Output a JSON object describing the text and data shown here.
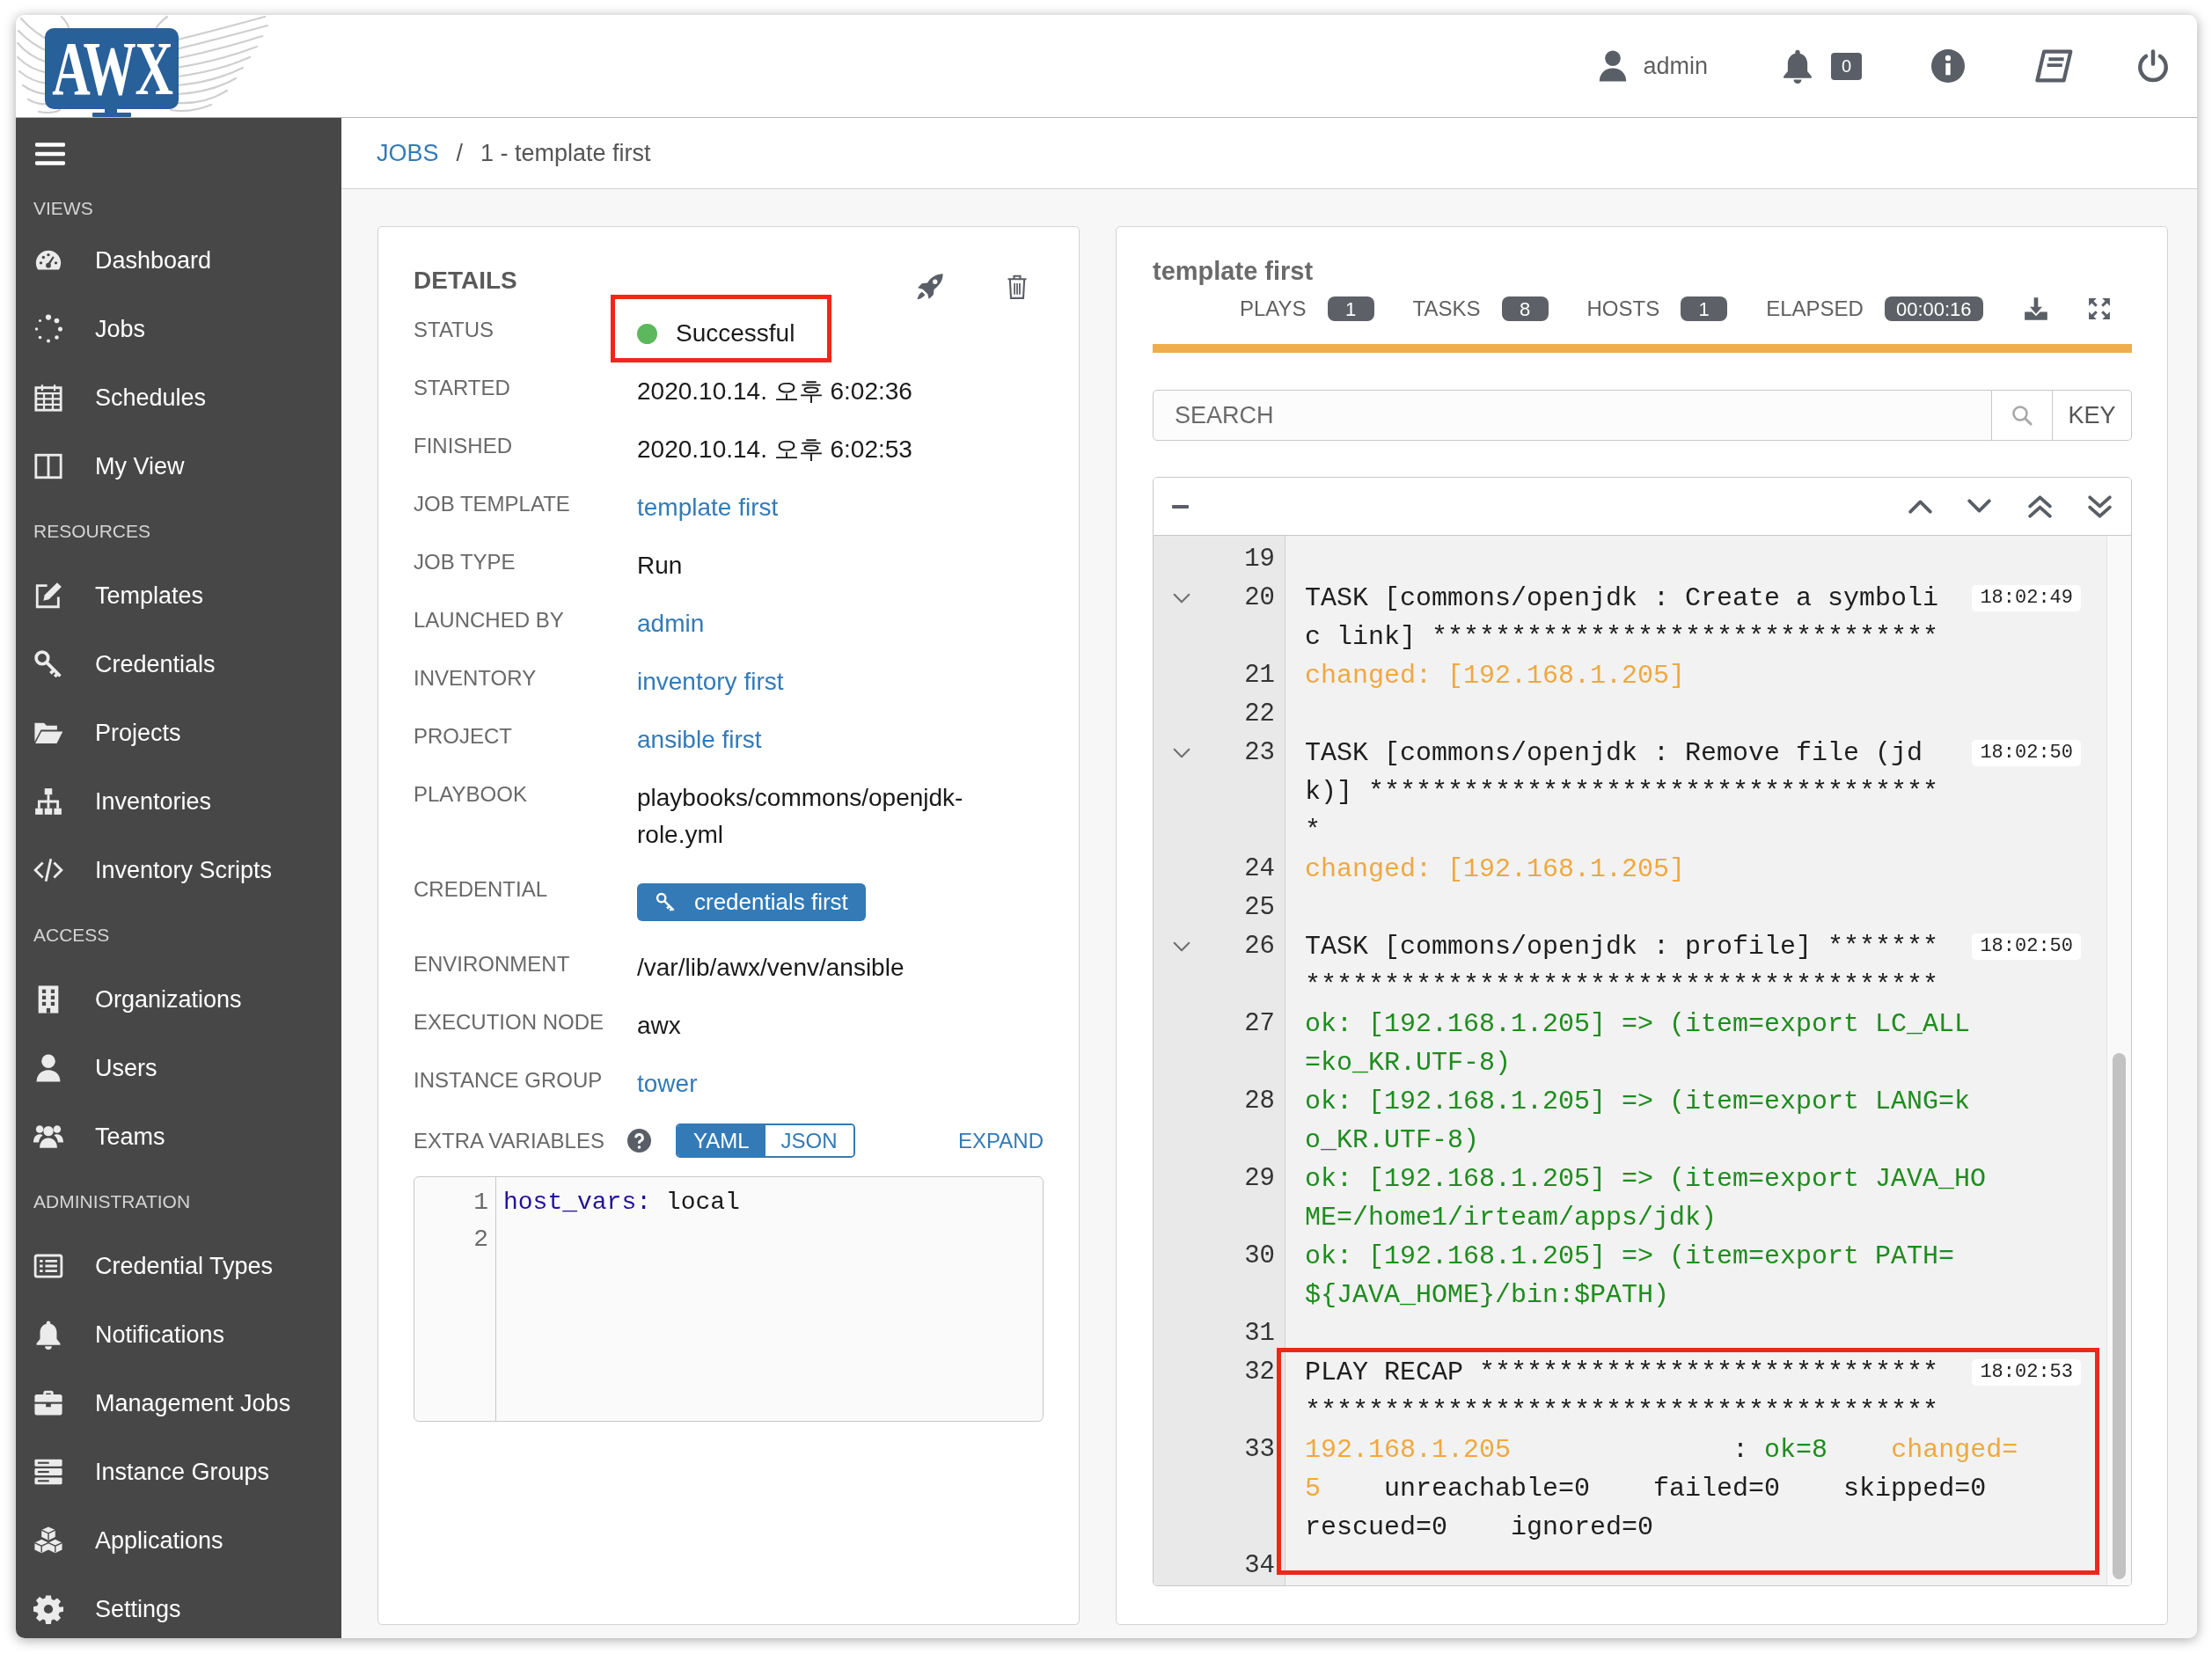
{
  "header": {
    "logo": "AWX",
    "user": "admin",
    "notification_count": "0"
  },
  "sidebar": {
    "sections": [
      {
        "title": "VIEWS",
        "items": [
          "Dashboard",
          "Jobs",
          "Schedules",
          "My View"
        ]
      },
      {
        "title": "RESOURCES",
        "items": [
          "Templates",
          "Credentials",
          "Projects",
          "Inventories",
          "Inventory Scripts"
        ]
      },
      {
        "title": "ACCESS",
        "items": [
          "Organizations",
          "Users",
          "Teams"
        ]
      },
      {
        "title": "ADMINISTRATION",
        "items": [
          "Credential Types",
          "Notifications",
          "Management Jobs",
          "Instance Groups",
          "Applications",
          "Settings"
        ]
      }
    ]
  },
  "breadcrumb": {
    "separator": "/",
    "items": [
      {
        "label": "JOBS",
        "kind": "link"
      },
      {
        "label": "1 - template first",
        "kind": "current"
      }
    ]
  },
  "details": {
    "title": "DETAILS",
    "fields": [
      {
        "label": "STATUS",
        "kind": "status",
        "value": "Successful",
        "color": "#5cb85c",
        "highlighted": true
      },
      {
        "label": "STARTED",
        "kind": "text",
        "value": "2020.10.14. 오후 6:02:36"
      },
      {
        "label": "FINISHED",
        "kind": "text",
        "value": "2020.10.14. 오후 6:02:53"
      },
      {
        "label": "JOB TEMPLATE",
        "kind": "link",
        "value": "template first"
      },
      {
        "label": "JOB TYPE",
        "kind": "text",
        "value": "Run"
      },
      {
        "label": "LAUNCHED BY",
        "kind": "link",
        "value": "admin"
      },
      {
        "label": "INVENTORY",
        "kind": "link",
        "value": "inventory first"
      },
      {
        "label": "PROJECT",
        "kind": "link",
        "value": "ansible first"
      },
      {
        "label": "PLAYBOOK",
        "kind": "text",
        "value": "playbooks/commons/openjdk-role.yml"
      },
      {
        "label": "CREDENTIAL",
        "kind": "chip",
        "value": "credentials first"
      },
      {
        "label": "ENVIRONMENT",
        "kind": "text",
        "value": "/var/lib/awx/venv/ansible"
      },
      {
        "label": "EXECUTION NODE",
        "kind": "text",
        "value": "awx"
      },
      {
        "label": "INSTANCE GROUP",
        "kind": "link",
        "value": "tower"
      }
    ],
    "extra_variables": {
      "label": "EXTRA VARIABLES",
      "modes": [
        {
          "label": "YAML",
          "selected": true
        },
        {
          "label": "JSON",
          "selected": false
        }
      ],
      "expand": "EXPAND",
      "code": [
        {
          "number": "1",
          "segments": [
            {
              "text": "host_vars:",
              "kind": "key"
            },
            {
              "text": " local",
              "kind": "plain"
            }
          ]
        },
        {
          "number": "2"
        }
      ]
    }
  },
  "job_output": {
    "title": "template first",
    "stats": [
      {
        "label": "PLAYS",
        "value": "1"
      },
      {
        "label": "TASKS",
        "value": "8"
      },
      {
        "label": "HOSTS",
        "value": "1"
      },
      {
        "label": "ELAPSED",
        "value": "00:00:16"
      }
    ],
    "status_bar": {
      "level": 1
    },
    "search": {
      "placeholder": "SEARCH",
      "key_button": "KEY"
    },
    "lines": [
      {
        "number": "19"
      },
      {
        "number": "20",
        "kind": "task",
        "expanded": true,
        "time": "18:02:49",
        "rows": [
          "TASK [commons/openjdk : Create a symboli",
          "c link] ********************************"
        ]
      },
      {
        "number": "21",
        "kind": "changed",
        "rows": [
          "changed: [192.168.1.205]"
        ]
      },
      {
        "number": "22"
      },
      {
        "number": "23",
        "kind": "task",
        "expanded": true,
        "time": "18:02:50",
        "rows": [
          "TASK [commons/openjdk : Remove file (jd",
          "k)] ************************************",
          "*"
        ]
      },
      {
        "number": "24",
        "kind": "changed",
        "rows": [
          "changed: [192.168.1.205]"
        ]
      },
      {
        "number": "25"
      },
      {
        "number": "26",
        "kind": "task",
        "expanded": true,
        "time": "18:02:50",
        "rows": [
          "TASK [commons/openjdk : profile] *******",
          "****************************************"
        ]
      },
      {
        "number": "27",
        "kind": "ok",
        "rows": [
          "ok: [192.168.1.205] => (item=export LC_ALL",
          "=ko_KR.UTF-8)"
        ]
      },
      {
        "number": "28",
        "kind": "ok",
        "rows": [
          "ok: [192.168.1.205] => (item=export LANG=k",
          "o_KR.UTF-8)"
        ]
      },
      {
        "number": "29",
        "kind": "ok",
        "rows": [
          "ok: [192.168.1.205] => (item=export JAVA_HO",
          "ME=/home1/irteam/apps/jdk)"
        ]
      },
      {
        "number": "30",
        "kind": "ok",
        "rows": [
          "ok: [192.168.1.205] => (item=export PATH=",
          "${JAVA_HOME}/bin:$PATH)"
        ]
      },
      {
        "number": "31"
      },
      {
        "number": "32",
        "kind": "play",
        "time": "18:02:53",
        "highlighted": true,
        "rows": [
          "PLAY RECAP *****************************",
          "****************************************"
        ]
      },
      {
        "number": "33",
        "kind": "stats",
        "highlighted": true,
        "rows": [
          [
            {
              "text": "192.168.1.205",
              "kind": "changed"
            },
            {
              "text": "              : ",
              "kind": "plain"
            },
            {
              "text": "ok=8",
              "kind": "ok"
            },
            {
              "text": "    ",
              "kind": "plain"
            },
            {
              "text": "changed=",
              "kind": "changed"
            }
          ],
          [
            {
              "text": "5",
              "kind": "changed"
            },
            {
              "text": "    unreachable=0    failed=0    skipped=0",
              "kind": "plain"
            }
          ],
          [
            {
              "text": "rescued=0    ignored=0",
              "kind": "plain"
            }
          ]
        ]
      },
      {
        "number": "34",
        "highlighted": true
      }
    ]
  }
}
